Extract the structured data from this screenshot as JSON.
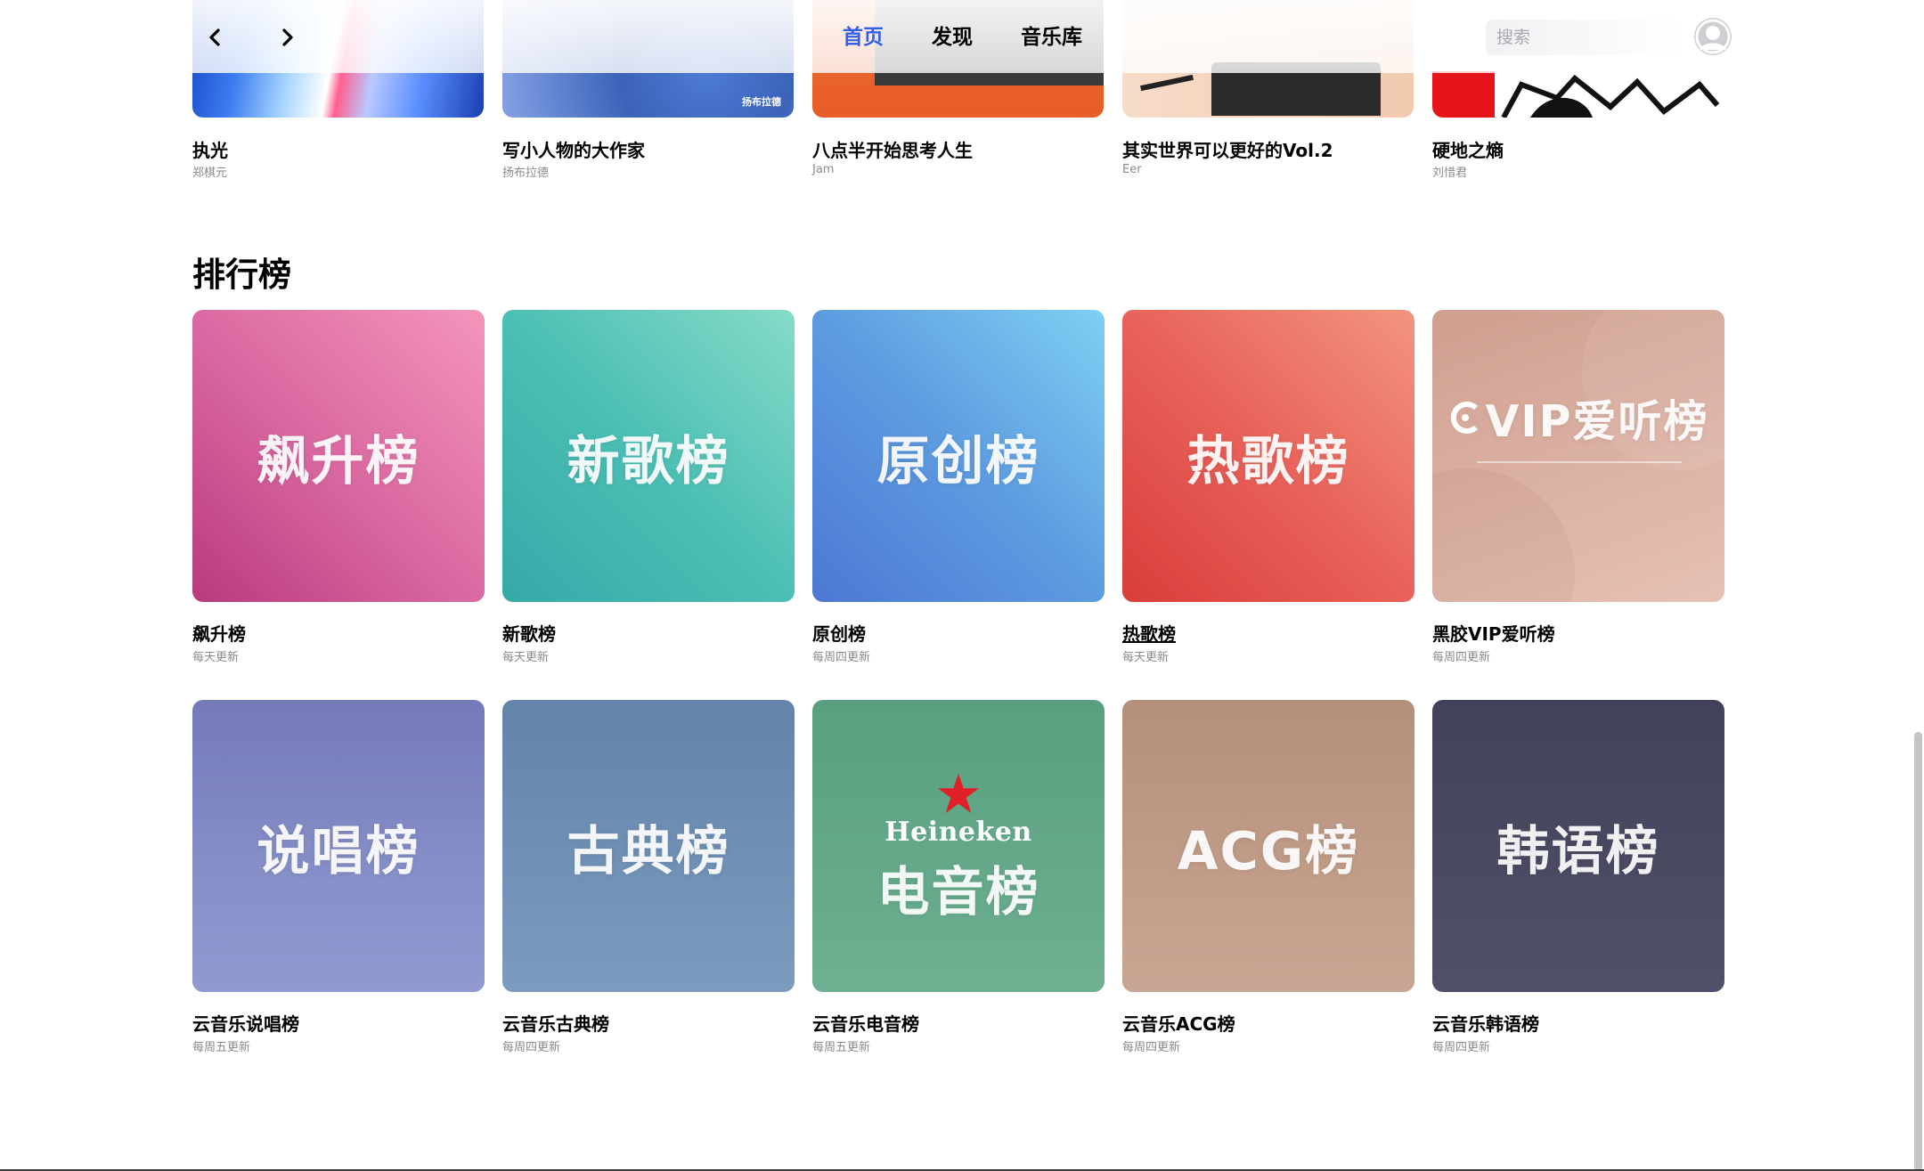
{
  "nav": {
    "tabs": [
      "首页",
      "发现",
      "音乐库"
    ],
    "active_tab": 0,
    "search_placeholder": "搜索",
    "accent": "#335eea"
  },
  "playlists": [
    {
      "title": "执光",
      "artist": "郑棋元"
    },
    {
      "title": "写小人物的大作家",
      "artist": "扬布拉德",
      "cover_text": "扬布拉德"
    },
    {
      "title": "八点半开始思考人生",
      "artist": "Jam"
    },
    {
      "title": "其实世界可以更好的Vol.2",
      "artist": "Eer"
    },
    {
      "title": "硬地之熵",
      "artist": "刘惜君"
    }
  ],
  "charts_section": {
    "title": "排行榜",
    "items": [
      {
        "cover_text": "飙升榜",
        "name": "飙升榜",
        "update": "每天更新"
      },
      {
        "cover_text": "新歌榜",
        "name": "新歌榜",
        "update": "每天更新"
      },
      {
        "cover_text": "原创榜",
        "name": "原创榜",
        "update": "每周四更新"
      },
      {
        "cover_text": "热歌榜",
        "name": "热歌榜",
        "update": "每天更新"
      },
      {
        "cover_text": "VIP爱听榜",
        "name": "黑胶VIP爱听榜",
        "update": "每周四更新"
      },
      {
        "cover_text": "说唱榜",
        "name": "云音乐说唱榜",
        "update": "每周五更新"
      },
      {
        "cover_text": "古典榜",
        "name": "云音乐古典榜",
        "update": "每周四更新"
      },
      {
        "cover_text": "电音榜",
        "brand_text": "Heineken",
        "name": "云音乐电音榜",
        "update": "每周五更新"
      },
      {
        "cover_text": "ACG榜",
        "name": "云音乐ACG榜",
        "update": "每周四更新"
      },
      {
        "cover_text": "韩语榜",
        "name": "云音乐韩语榜",
        "update": "每周四更新"
      }
    ]
  }
}
